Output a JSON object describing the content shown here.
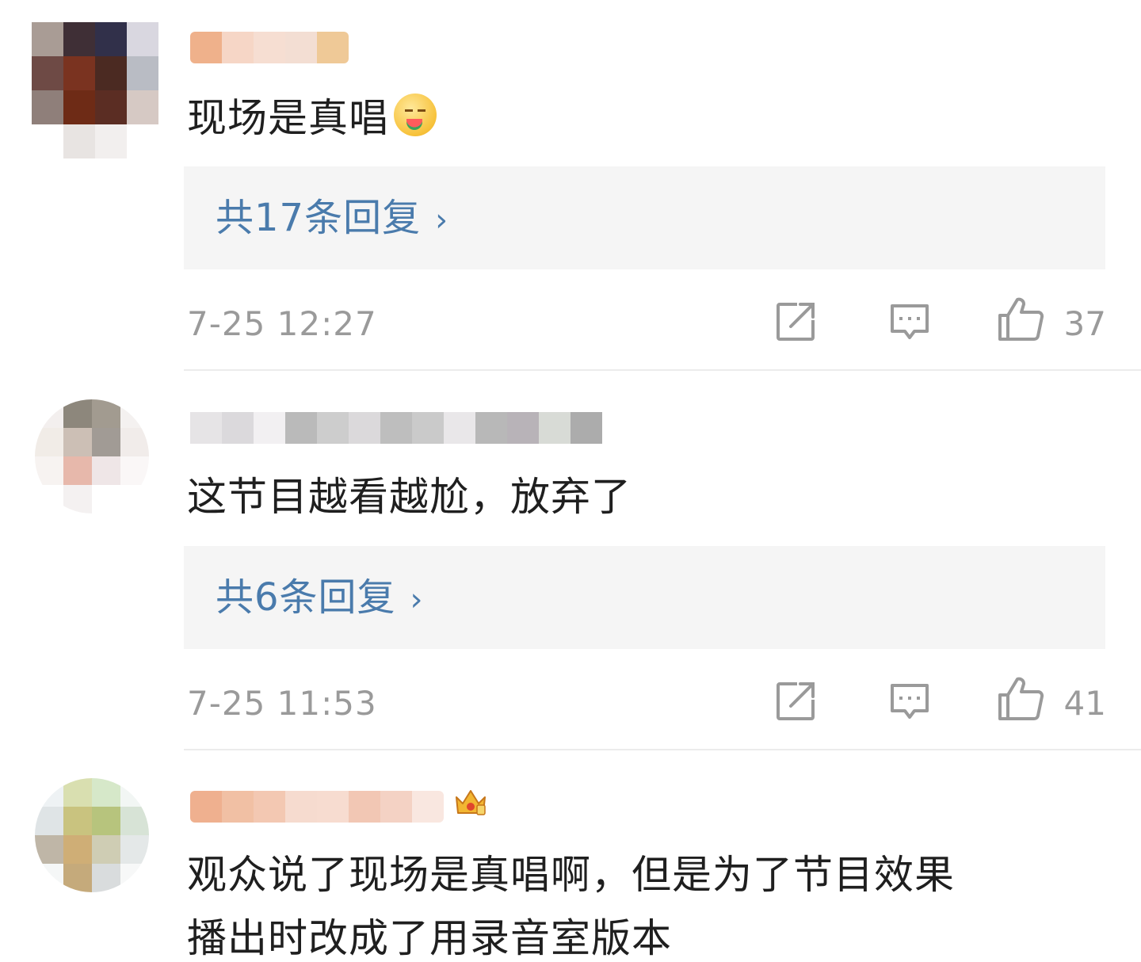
{
  "comments": [
    {
      "text": "现场是真唱",
      "emoji": "drooling-watermelon-emoji",
      "replies_label": "共17条回复",
      "reply_chevron": "›",
      "timestamp": "7-25 12:27",
      "likes": "37"
    },
    {
      "text": "这节目越看越尬，放弃了",
      "replies_label": "共6条回复",
      "reply_chevron": "›",
      "timestamp": "7-25 11:53",
      "likes": "41"
    },
    {
      "text_line1": "观众说了现场是真唱啊，但是为了节目效果",
      "text_line2": "播出时改成了用录音室版本",
      "badge": "crown-badge-icon"
    }
  ],
  "icons": {
    "share": "share-icon",
    "comment": "comment-icon",
    "like": "thumbs-up-icon"
  },
  "colors": {
    "link": "#4a7bac",
    "meta": "#9a9a9a",
    "reply_bg": "#f5f5f5",
    "divider": "#ececec"
  }
}
